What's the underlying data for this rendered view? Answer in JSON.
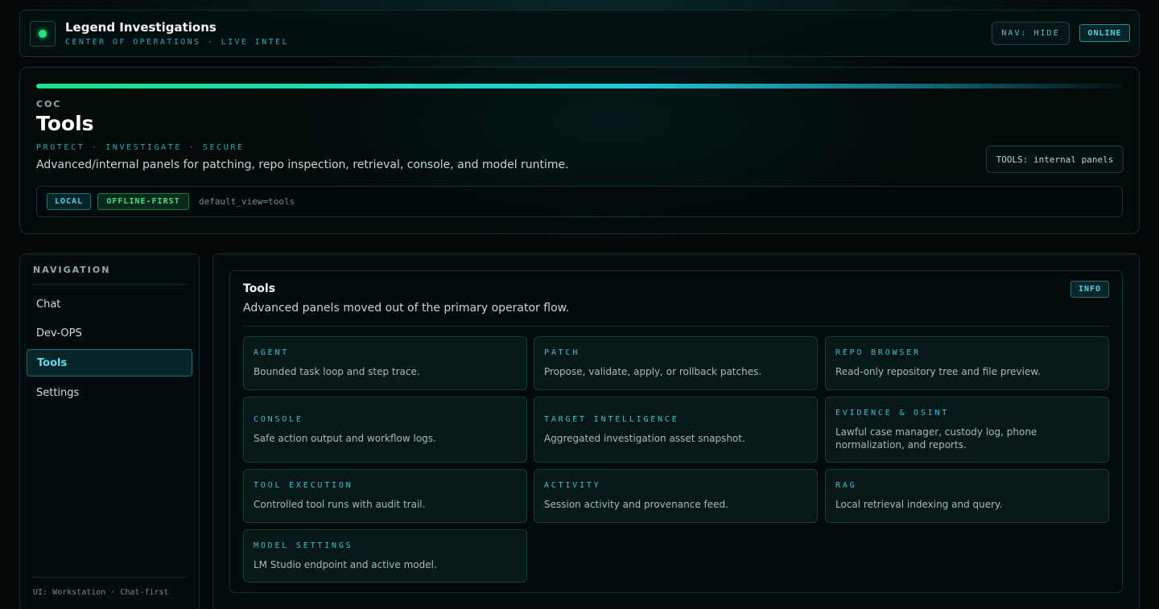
{
  "header": {
    "title": "Legend Investigations",
    "subtitle": "CENTER OF OPERATIONS · LIVE INTEL",
    "nav_toggle": "NAV: HIDE",
    "status": "ONLINE",
    "status_color": "#22e07a"
  },
  "hero": {
    "eyebrow": "COC",
    "title": "Tools",
    "tagline": "PROTECT · INVESTIGATE · SECURE",
    "description": "Advanced/internal panels for patching, repo inspection, retrieval, console, and model runtime.",
    "chip": "TOOLS: internal panels",
    "tags": {
      "local": "LOCAL",
      "offline": "OFFLINE-FIRST",
      "view": "default_view=tools"
    }
  },
  "sidebar": {
    "title": "NAVIGATION",
    "items": [
      {
        "label": "Chat",
        "active": false
      },
      {
        "label": "Dev-OPS",
        "active": false
      },
      {
        "label": "Tools",
        "active": true
      },
      {
        "label": "Settings",
        "active": false
      }
    ],
    "footer": "UI: Workstation · Chat-first"
  },
  "main": {
    "panel": {
      "title": "Tools",
      "description": "Advanced panels moved out of the primary operator flow.",
      "badge": "INFO",
      "tools": [
        {
          "name": "AGENT",
          "description": "Bounded task loop and step trace."
        },
        {
          "name": "PATCH",
          "description": "Propose, validate, apply, or rollback patches."
        },
        {
          "name": "REPO BROWSER",
          "description": "Read-only repository tree and file preview."
        },
        {
          "name": "CONSOLE",
          "description": "Safe action output and workflow logs."
        },
        {
          "name": "TARGET INTELLIGENCE",
          "description": "Aggregated investigation asset snapshot."
        },
        {
          "name": "EVIDENCE & OSINT",
          "description": "Lawful case manager, custody log, phone normalization, and reports."
        },
        {
          "name": "TOOL EXECUTION",
          "description": "Controlled tool runs with audit trail."
        },
        {
          "name": "ACTIVITY",
          "description": "Session activity and provenance feed."
        },
        {
          "name": "RAG",
          "description": "Local retrieval indexing and query."
        },
        {
          "name": "MODEL SETTINGS",
          "description": "LM Studio endpoint and active model."
        }
      ]
    }
  },
  "colors": {
    "accent": "#33c3d3",
    "success": "#3fe08a",
    "background": "#030808"
  }
}
